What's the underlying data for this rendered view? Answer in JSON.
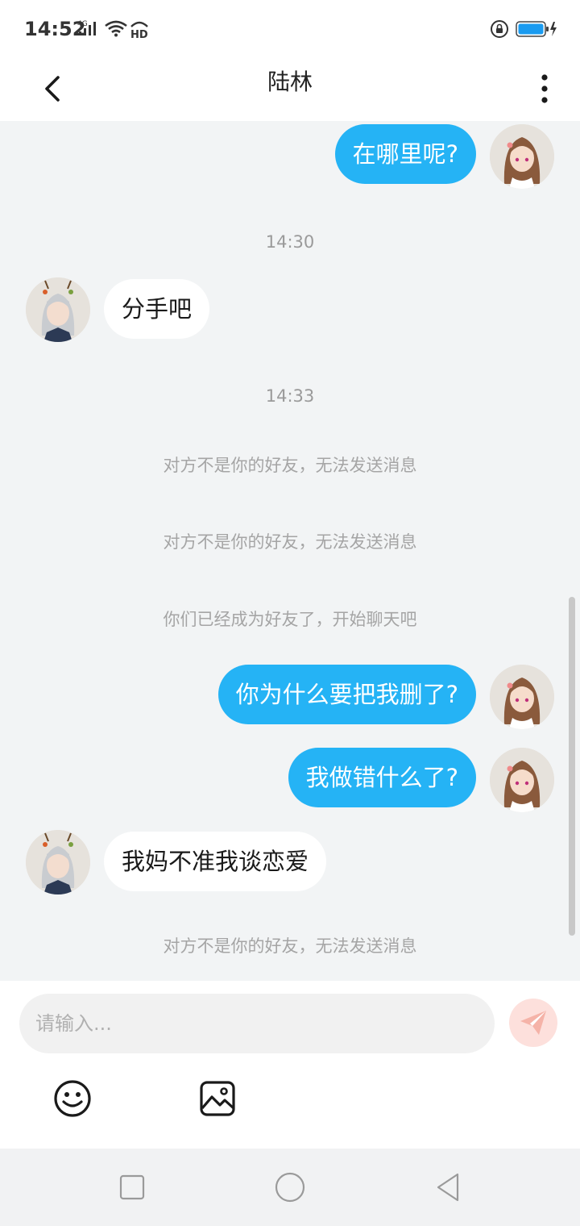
{
  "status_bar": {
    "time": "14:52",
    "network_label": "4G",
    "hd_label": "HD",
    "icons": [
      "cellular-signal-icon",
      "wifi-icon",
      "hd-icon",
      "rotation-lock-icon",
      "battery-charging-icon"
    ],
    "battery_color": "#1a9bf0"
  },
  "header": {
    "title": "陆林",
    "back_icon": "chevron-left-icon",
    "more_icon": "vertical-dots-icon"
  },
  "messages": [
    {
      "type": "outgoing",
      "text": "在哪里呢?"
    },
    {
      "type": "timestamp",
      "text": "14:30"
    },
    {
      "type": "incoming",
      "text": "分手吧"
    },
    {
      "type": "timestamp",
      "text": "14:33"
    },
    {
      "type": "system",
      "text": "对方不是你的好友，无法发送消息"
    },
    {
      "type": "system",
      "text": "对方不是你的好友，无法发送消息"
    },
    {
      "type": "system",
      "text": "你们已经成为好友了，开始聊天吧"
    },
    {
      "type": "outgoing",
      "text": "你为什么要把我删了?"
    },
    {
      "type": "outgoing",
      "text": "我做错什么了?"
    },
    {
      "type": "incoming",
      "text": "我妈不准我谈恋爱"
    },
    {
      "type": "system",
      "text": "对方不是你的好友，无法发送消息"
    }
  ],
  "input": {
    "placeholder": "请输入...",
    "value": "",
    "send_icon": "send-plane-icon",
    "emoji_icon": "emoji-smile-icon",
    "image_icon": "image-picture-icon"
  },
  "nav_bar": {
    "icons": [
      "recent-apps-icon",
      "home-icon",
      "back-icon"
    ]
  },
  "colors": {
    "outgoing_bubble": "#25b3f5",
    "incoming_bubble": "#ffffff",
    "chat_background": "#f2f4f5",
    "send_button": "#fde0dc"
  }
}
